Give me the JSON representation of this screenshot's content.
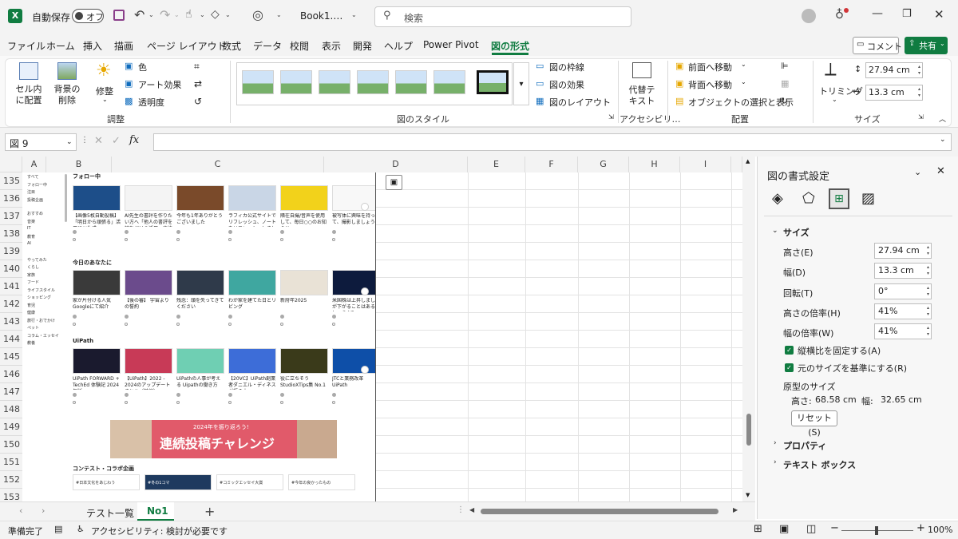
{
  "titlebar": {
    "autosave": "自動保存",
    "toggle": "オフ",
    "filename": "Book1.…",
    "search_placeholder": "検索"
  },
  "menu": {
    "items": [
      "ファイル",
      "ホーム",
      "挿入",
      "描画",
      "ページ レイアウト",
      "数式",
      "データ",
      "校閲",
      "表示",
      "開発",
      "ヘルプ",
      "Power Pivot",
      "図の形式"
    ],
    "comment": "コメント",
    "share": "共有"
  },
  "ribbon": {
    "remove_bg": "セル内に配置",
    "bg_delete": "背景の削除",
    "corrections": "修整",
    "color": "色",
    "art_effects": "アート効果",
    "transparency": "透明度",
    "group_adjust": "調整",
    "group_styles": "図のスタイル",
    "border": "図の枠線",
    "effects": "図の効果",
    "layout": "図のレイアウト",
    "alt_text": "代替テキスト",
    "group_access": "アクセシビリ…",
    "bring_forward": "前面へ移動",
    "send_backward": "背面へ移動",
    "selection_pane": "オブジェクトの選択と表示",
    "group_arrange": "配置",
    "crop": "トリミング",
    "height": "27.94 cm",
    "width": "13.3 cm",
    "group_size": "サイズ"
  },
  "formula": {
    "namebox": "図 9",
    "fx": "fx"
  },
  "columns": [
    "A",
    "B",
    "C",
    "D",
    "E",
    "F",
    "G",
    "H",
    "I"
  ],
  "rows": [
    "135",
    "136",
    "137",
    "138",
    "139",
    "140",
    "141",
    "142",
    "143",
    "144",
    "145",
    "146",
    "147",
    "148",
    "149",
    "150",
    "151",
    "152",
    "153"
  ],
  "embed": {
    "sidebar": [
      "すべて",
      "フォロー中",
      "注目",
      "投稿企画",
      "おすすめ",
      "音楽",
      "IT",
      "教育",
      "AI",
      "やってみた",
      "くらし",
      "家族",
      "フード",
      "ライフスタイル",
      "ショッピング",
      "育児",
      "健康",
      "旅行・おでかけ",
      "ペット",
      "コラム・エッセイ",
      "教養"
    ],
    "sec_follow": "フォロー中",
    "sec_today": "今日のあなたに",
    "sec_uipath": "UiPath",
    "sec_contest": "コンテスト・コラボ企画",
    "banner_small": "2024年を振り返ろう!",
    "banner_big": "連続投稿チャレンジ",
    "row1": [
      "【画像5枚自動投稿】「明日から頑張る」活用にAI生成",
      "AI先生の書評を作りたい方へ「他人の書評を読むだけの活用」方法",
      "今年も1年ありがとうございました",
      "ラフィカ公式サイトでリフレッシュ、ノートをリフレッシュしました",
      "隣在自撮/音声を使用して、毎日○○のお知らせ",
      "被写体に興味を持って、撮影しましょう"
    ],
    "row2": [
      "家が片付ける人気 Googleにて紹介",
      "【後の審】 宇宙よりの誓約",
      "残念：頭を失ってきてください",
      "わが家を建てた日とリビング",
      "新府年2025",
      "米国株は上昇しましたが下がることはあるでしょうか？"
    ],
    "row3": [
      "UiPath FORWARD + TechEd 体験記 2024年版",
      "【UiPath】2022 - 2024のアップデートまとめ（前編）",
      "UiPathの人事が考える Uipathの働き方",
      "【20VC】UiPath創業者ダニエル・ディネスが語る本",
      "役に立ちそう StudioXTips集 No.1",
      "JTCと業務改革 UiPath"
    ],
    "contest": [
      "#日本文化をあじわう",
      "#冬の1コマ",
      "#コミックエッセイ大賞",
      "#今年の良かったもの"
    ]
  },
  "pane": {
    "title": "図の書式設定",
    "size_header": "サイズ",
    "height_label": "高さ(E)",
    "height_val": "27.94 cm",
    "width_label": "幅(D)",
    "width_val": "13.3 cm",
    "rotation_label": "回転(T)",
    "rotation_val": "0°",
    "scale_h_label": "高さの倍率(H)",
    "scale_h_val": "41%",
    "scale_w_label": "幅の倍率(W)",
    "scale_w_val": "41%",
    "lock_aspect": "縦横比を固定する(A)",
    "relative": "元のサイズを基準にする(R)",
    "orig_size": "原型のサイズ",
    "orig_h_label": "高さ:",
    "orig_h": "68.58 cm",
    "orig_w_label": "幅:",
    "orig_w": "32.65 cm",
    "reset": "リセット(S)",
    "properties": "プロパティ",
    "textbox": "テキスト ボックス"
  },
  "sheets": [
    "テスト一覧",
    "No1"
  ],
  "status": {
    "ready": "準備完了",
    "accessibility": "アクセシビリティ: 検討が必要です",
    "zoom": "100%"
  },
  "colors": {
    "excel_green": "#107c41",
    "accent": "#0f6cbd"
  }
}
